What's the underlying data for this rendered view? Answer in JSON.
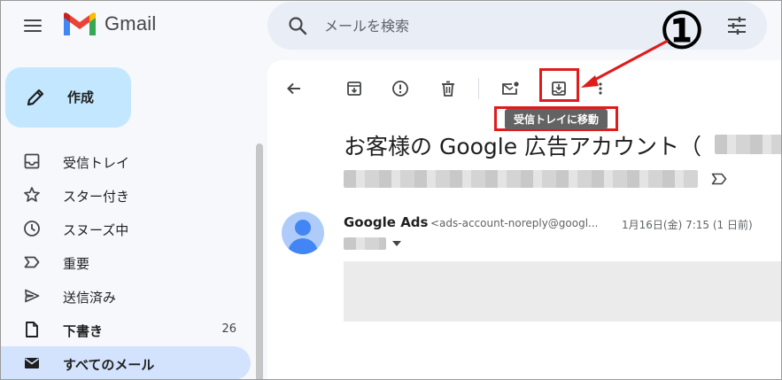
{
  "app": {
    "name": "Gmail"
  },
  "search": {
    "placeholder": "メールを検索"
  },
  "compose": {
    "label": "作成"
  },
  "nav": [
    {
      "label": "受信トレイ",
      "icon": "inbox-icon",
      "count": "",
      "bold": false,
      "active": false
    },
    {
      "label": "スター付き",
      "icon": "star-icon",
      "count": "",
      "bold": false,
      "active": false
    },
    {
      "label": "スヌーズ中",
      "icon": "clock-icon",
      "count": "",
      "bold": false,
      "active": false
    },
    {
      "label": "重要",
      "icon": "label-important-icon",
      "count": "",
      "bold": false,
      "active": false
    },
    {
      "label": "送信済み",
      "icon": "send-icon",
      "count": "",
      "bold": false,
      "active": false
    },
    {
      "label": "下書き",
      "icon": "draft-icon",
      "count": "26",
      "bold": true,
      "active": false
    },
    {
      "label": "すべてのメール",
      "icon": "mail-icon",
      "count": "",
      "bold": true,
      "active": true
    }
  ],
  "toolbar": {
    "tooltip": "受信トレイに移動",
    "buttons": [
      "back-icon",
      "archive-icon",
      "report-spam-icon",
      "delete-icon",
      "mark-unread-icon",
      "move-to-inbox-icon",
      "more-icon"
    ]
  },
  "annotation": {
    "number": "①"
  },
  "email": {
    "subject": "お客様の Google 広告アカウント（",
    "sender": "Google Ads",
    "sender_email": "<ads-account-noreply@googl...",
    "date": "1月16日(金) 7:15 (1 日前)"
  },
  "colors": {
    "accent_red": "#e01b1b",
    "compose_bg": "#c2e7ff",
    "active_nav": "#d3e3fd",
    "search_bg": "#e9eef6"
  }
}
